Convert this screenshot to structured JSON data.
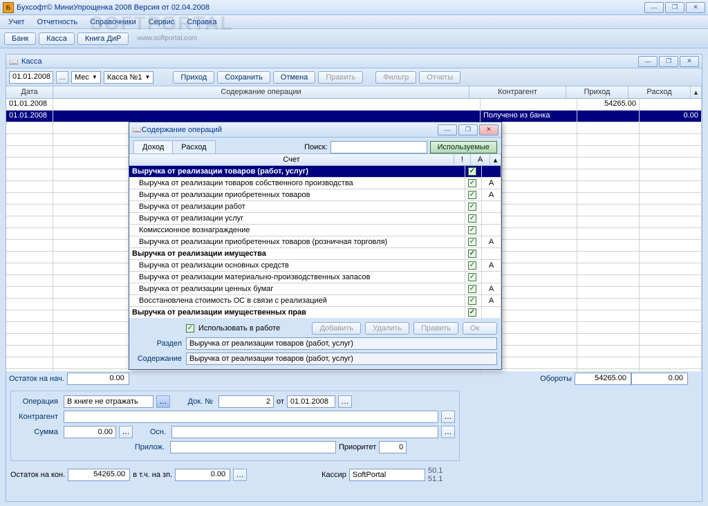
{
  "app": {
    "icon_letter": "Б",
    "title": "Бухсофт©  МиниУпрощенка 2008 Версия от 02.04.2008"
  },
  "menu": [
    "Учет",
    "Отчетность",
    "Справочники",
    "Сервис",
    "Справка"
  ],
  "main_toolbar": {
    "bank": "Банк",
    "kassa": "Касса",
    "book": "Книга ДиР",
    "url": "www.softportal.com"
  },
  "watermark": "SOFTPORTAL",
  "sub": {
    "title": "Касса",
    "date": "01.01.2008",
    "period": "Мес",
    "kassa": "Касса №1",
    "buttons": {
      "prihod": "Приход",
      "save": "Сохранить",
      "cancel": "Отмена",
      "edit": "Править",
      "filter": "Фильтр",
      "reports": "Отчеты"
    }
  },
  "grid": {
    "headers": {
      "date": "Дата",
      "desc": "Содержание операции",
      "contr": "Контрагент",
      "in": "Приход",
      "out": "Расход"
    },
    "rows": [
      {
        "date": "01.01.2008",
        "desc": "",
        "contr": "",
        "in": "54265.00",
        "out": "",
        "sel": false
      },
      {
        "date": "01.01.2008",
        "desc": "",
        "contr": "Получено из банка",
        "in": "",
        "out": "0.00",
        "sel": true
      }
    ]
  },
  "summary": {
    "start_lbl": "Остаток на нач.",
    "start_val": "0.00",
    "turn_lbl": "Обороты",
    "turn_in": "54265.00",
    "turn_out": "0.00"
  },
  "form": {
    "operation_lbl": "Операция",
    "operation_val": "В книге не отражать",
    "docnum_lbl": "Док. №",
    "docnum_val": "2",
    "ot_lbl": "от",
    "ot_val": "01.01.2008",
    "contr_lbl": "Контрагент",
    "contr_val": "",
    "sum_lbl": "Сумма",
    "sum_val": "0.00",
    "osn_lbl": "Осн.",
    "osn_val": "",
    "pril_lbl": "Прилож.",
    "pril_val": "",
    "prior_lbl": "Приоритет",
    "prior_val": "0"
  },
  "bottom": {
    "end_lbl": "Остаток на кон.",
    "end_val": "54265.00",
    "incl_lbl": "в т.ч. на зп.",
    "incl_val": "0.00",
    "cashier_lbl": "Кассир",
    "cashier_val": "SoftPortal",
    "codes": [
      "50.1",
      "51.1"
    ]
  },
  "dialog": {
    "title": "Содержание операций",
    "tabs": {
      "income": "Доход",
      "expense": "Расход"
    },
    "search_lbl": "Поиск:",
    "search_val": "",
    "used_btn": "Используемые",
    "headers": {
      "name": "Счет",
      "chk": "!",
      "a": "А"
    },
    "rows": [
      {
        "text": "Выручка от реализации товаров (работ, услуг)",
        "group": true,
        "sel": true,
        "chk": true,
        "a": ""
      },
      {
        "text": "Выручка от реализации товаров собственного производства",
        "chk": true,
        "a": "А",
        "indent": true
      },
      {
        "text": "Выручка от реализации приобретенных товаров",
        "chk": true,
        "a": "А",
        "indent": true
      },
      {
        "text": "Выручка от реализации работ",
        "chk": true,
        "a": "",
        "indent": true
      },
      {
        "text": "Выручка от реализации услуг",
        "chk": true,
        "a": "",
        "indent": true
      },
      {
        "text": "Комиссионное вознаграждение",
        "chk": true,
        "a": "",
        "indent": true
      },
      {
        "text": "Выручка от реализации приобретенных товаров (розничная торговля)",
        "chk": true,
        "a": "А",
        "indent": true
      },
      {
        "text": "Выручка от реализации имущества",
        "group": true,
        "chk": true,
        "a": ""
      },
      {
        "text": "Выручка от реализации основных средств",
        "chk": true,
        "a": "А",
        "indent": true
      },
      {
        "text": "Выручка от реализации материально-производственных запасов",
        "chk": true,
        "a": "",
        "indent": true
      },
      {
        "text": "Выручка от реализации ценных бумаг",
        "chk": true,
        "a": "А",
        "indent": true
      },
      {
        "text": "Восстановлена стоимость ОС в связи с реализацией",
        "chk": true,
        "a": "А",
        "indent": true
      },
      {
        "text": "Выручка от реализации имущественных прав",
        "group": true,
        "chk": true,
        "a": ""
      }
    ],
    "use_lbl": "Использовать в работе",
    "btns": {
      "add": "Добавить",
      "del": "Удалить",
      "edit": "Править",
      "ok": "Ок"
    },
    "section_lbl": "Раздел",
    "section_val": "Выручка от реализации товаров (работ, услуг)",
    "content_lbl": "Содержание",
    "content_val": "Выручка от реализации товаров (работ, услуг)"
  }
}
